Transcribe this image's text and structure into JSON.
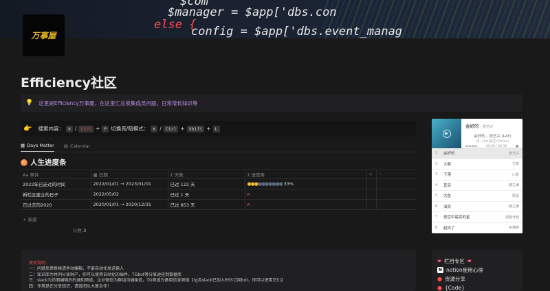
{
  "cover": {
    "code_lines": [
      "$com",
      "$manager = $app['dbs.con",
      "else {",
      "config = $app['dbs.event_manag"
    ]
  },
  "logo": {
    "text": "万事屋"
  },
  "page": {
    "title": "Efficiency社区"
  },
  "callout": {
    "icon": "lightbulb-icon",
    "text": "这里是Efficiency万事屋，在这里汇总收集成员问题，日常增长知识等"
  },
  "hint": {
    "icon": "pointing-hand-icon",
    "search_label": "搜索内容：",
    "keys1": [
      "⌘",
      "Ctrl",
      "P"
    ],
    "sep1": "/",
    "plus": "+",
    "switch_label": "切换亮/暗模式：",
    "keys2": [
      "⌘",
      "Ctrl",
      "Shift",
      "L"
    ]
  },
  "tabs": [
    {
      "label": "Days Matter",
      "icon": "table-icon",
      "active": true
    },
    {
      "label": "Calendar",
      "icon": "calendar-icon",
      "active": false
    }
  ],
  "database": {
    "title": "人生进度条",
    "columns": [
      "事件",
      "日期",
      "天数",
      "进度条",
      "+",
      "···"
    ],
    "column_icons": [
      "Aa",
      "▦",
      "Σ",
      "Σ"
    ],
    "rows": [
      {
        "event": "2022年已走过的时间",
        "date": "2022/01/01 → 2023/01/01",
        "days": "已过 122 天",
        "progress_on": 3,
        "progress_total": 10,
        "progress_pct": "33%"
      },
      {
        "event": "新社区建立的日子",
        "date": "2022/05/02",
        "days": "已过 1 天",
        "progress_pct": ""
      },
      {
        "event": "已过去的2020",
        "date": "2020/01/01 → 2020/12/31",
        "days": "已过 853 天",
        "progress_pct": ""
      }
    ],
    "new_label": "+ 新建",
    "count_label": "计数",
    "count_value": "3"
  },
  "notes": {
    "heading": "使用说明:",
    "lines": [
      "一：问题反馈表格请手动编辑，不要自动化发送输入",
      "二：知识库为共同分享财产，你可以使用自动化的插件。TGbot等分享途径到数据库",
      "三：slack为页面编辑后的通知频道，企业微信为群组沟通渠道，TG频道为备用信息频道【tg及slack已加入RSS订阅bot，你可以使用它们】",
      "四：作用是在分享知识，请各团队大家合作！"
    ]
  },
  "music": {
    "now_title": "会好的",
    "now_artist": "- 张艺兴",
    "sub": "会好的 - 张艺兴 (LAY)",
    "lyric": "词：[Art]张艺兴/Alioss",
    "time": "00:00 / 03:30",
    "playlist": [
      {
        "n": "1",
        "title": "会好的",
        "artist": "张艺兴"
      },
      {
        "n": "2",
        "title": "大眠",
        "artist": "王菲"
      },
      {
        "n": "3",
        "title": "下落",
        "artist": "川青"
      },
      {
        "n": "4",
        "title": "其实",
        "artist": "薛之谦"
      },
      {
        "n": "5",
        "title": "大鱼",
        "artist": "周深"
      },
      {
        "n": "6",
        "title": "演员",
        "artist": "薛之谦"
      },
      {
        "n": "7",
        "title": "夜空中最亮的星",
        "artist": "逃跑计划"
      },
      {
        "n": "8",
        "title": "起风了",
        "artist": "买辣椒"
      }
    ]
  },
  "side": {
    "header": "栏目专区",
    "items": [
      {
        "icon": "notion-icon",
        "label": "notion使用心得"
      },
      {
        "icon": "pin-icon",
        "label": "资源分享"
      },
      {
        "icon": "pin-icon",
        "label": "{Code}"
      }
    ]
  }
}
